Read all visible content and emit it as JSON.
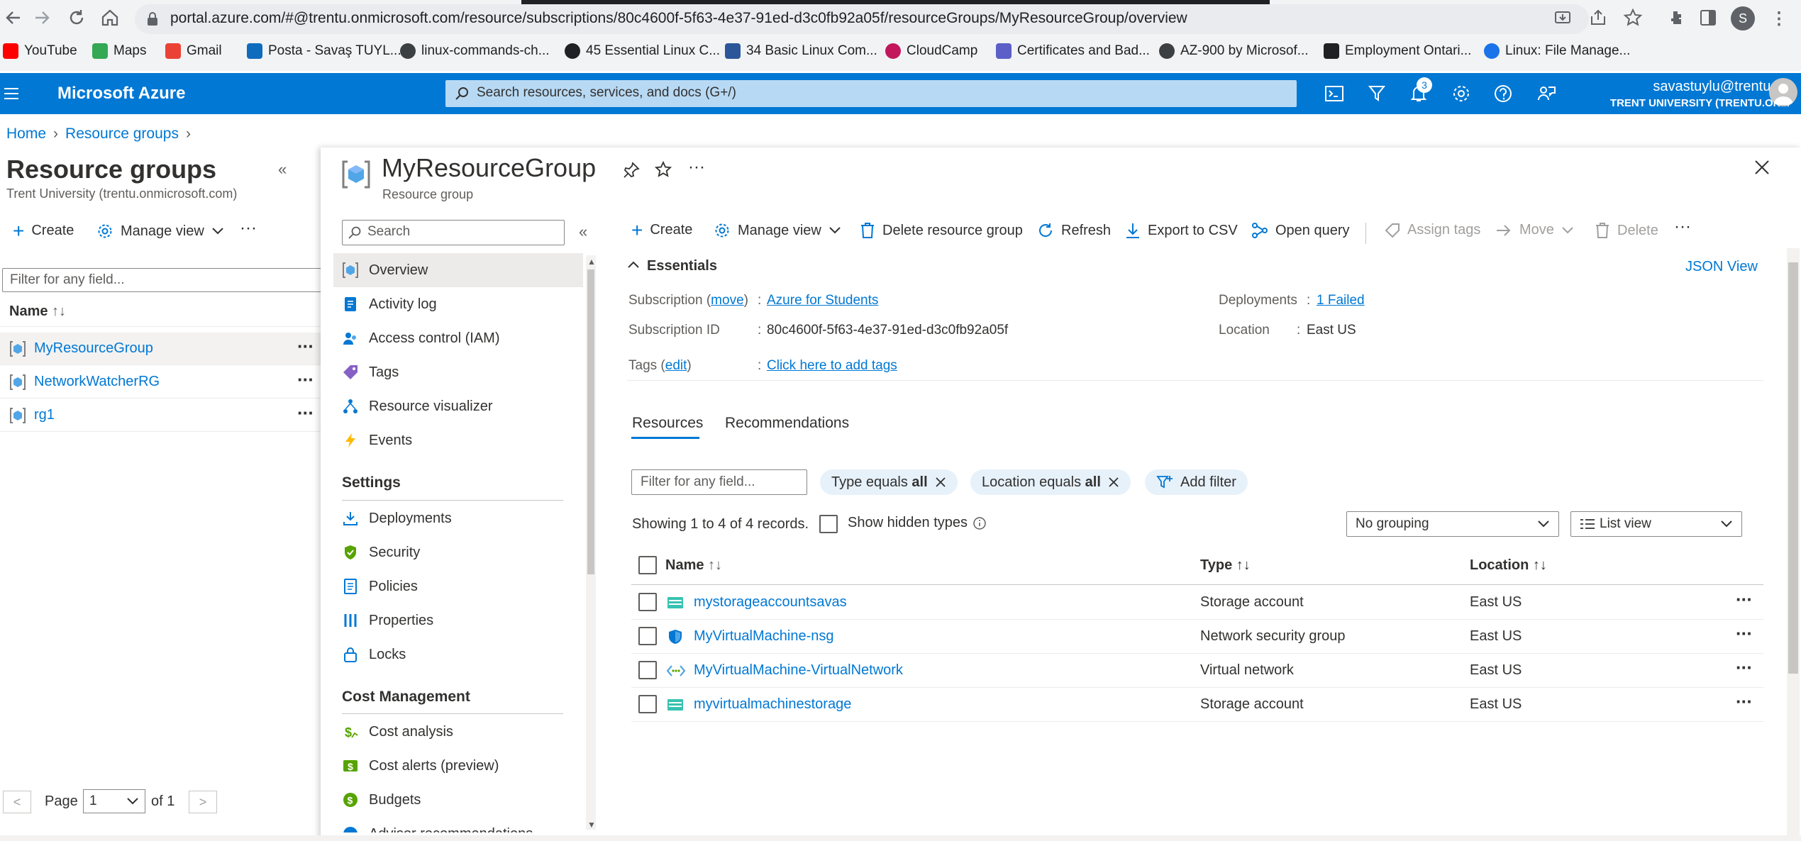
{
  "browser": {
    "url": "portal.azure.com/#@trentu.onmicrosoft.com/resource/subscriptions/80c4600f-5f63-4e37-91ed-d3c0fb92a05f/resourceGroups/MyResourceGroup/overview",
    "bookmarks": [
      {
        "label": "YouTube",
        "color": "#ff0000"
      },
      {
        "label": "Maps",
        "color": "#34a853"
      },
      {
        "label": "Gmail",
        "color": "#ea4335"
      },
      {
        "label": "Posta - Savaş TUYL...",
        "color": "#0f6cbd"
      },
      {
        "label": "linux-commands-ch...",
        "color": "#3c4043"
      },
      {
        "label": "45 Essential Linux C...",
        "color": "#202124"
      },
      {
        "label": "34 Basic Linux Com...",
        "color": "#2b579a"
      },
      {
        "label": "CloudCamp",
        "color": "#c2185b"
      },
      {
        "label": "Certificates and Bad...",
        "color": "#5b5fc7"
      },
      {
        "label": "AZ-900 by Microsof...",
        "color": "#3c4043"
      },
      {
        "label": "Employment Ontari...",
        "color": "#202124"
      },
      {
        "label": "Linux: File Manage...",
        "color": "#1a73e8"
      }
    ],
    "profile_initial": "S"
  },
  "header": {
    "brand": "Microsoft Azure",
    "search_placeholder": "Search resources, services, and docs (G+/)",
    "notification_count": "3",
    "user_name": "savastuylu@trentu.ca",
    "user_org": "TRENT UNIVERSITY (TRENTU.ON..."
  },
  "breadcrumb": {
    "home": "Home",
    "rg": "Resource groups"
  },
  "left_blade": {
    "title": "Resource groups",
    "subtitle": "Trent University (trentu.onmicrosoft.com)",
    "create": "Create",
    "manage_view": "Manage view",
    "filter_placeholder": "Filter for any field...",
    "name_header": "Name",
    "items": [
      {
        "name": "MyResourceGroup"
      },
      {
        "name": "NetworkWatcherRG"
      },
      {
        "name": "rg1"
      }
    ],
    "paging": {
      "prev": "<",
      "page_label": "Page",
      "page_value": "1",
      "of_label": "of 1",
      "next": ">"
    }
  },
  "resource_group": {
    "title": "MyResourceGroup",
    "subtitle": "Resource group",
    "menu_search": "Search",
    "menu": [
      {
        "label": "Overview",
        "icon": "overview-icon"
      },
      {
        "label": "Activity log",
        "icon": "activity-log-icon"
      },
      {
        "label": "Access control (IAM)",
        "icon": "iam-icon"
      },
      {
        "label": "Tags",
        "icon": "tag-icon"
      },
      {
        "label": "Resource visualizer",
        "icon": "visualizer-icon"
      },
      {
        "label": "Events",
        "icon": "lightning-icon"
      }
    ],
    "settings_header": "Settings",
    "settings": [
      {
        "label": "Deployments",
        "icon": "deployments-icon"
      },
      {
        "label": "Security",
        "icon": "shield-icon"
      },
      {
        "label": "Policies",
        "icon": "policy-icon"
      },
      {
        "label": "Properties",
        "icon": "properties-icon"
      },
      {
        "label": "Locks",
        "icon": "lock-icon"
      }
    ],
    "cost_header": "Cost Management",
    "cost": [
      {
        "label": "Cost analysis",
        "icon": "cost-analysis-icon"
      },
      {
        "label": "Cost alerts (preview)",
        "icon": "cost-alerts-icon"
      },
      {
        "label": "Budgets",
        "icon": "budgets-icon"
      },
      {
        "label": "Advisor recommendations",
        "icon": "advisor-icon"
      }
    ]
  },
  "toolbar": {
    "create": "Create",
    "manage_view": "Manage view",
    "delete_rg": "Delete resource group",
    "refresh": "Refresh",
    "export": "Export to CSV",
    "open_query": "Open query",
    "assign_tags": "Assign tags",
    "move": "Move",
    "delete": "Delete"
  },
  "essentials": {
    "header": "Essentials",
    "json_view": "JSON View",
    "subscription_label": "Subscription",
    "move_link": "move",
    "subscription_value": "Azure for Students",
    "subscription_id_label": "Subscription ID",
    "subscription_id": "80c4600f-5f63-4e37-91ed-d3c0fb92a05f",
    "tags_label": "Tags",
    "edit_link": "edit",
    "tags_value": "Click here to add tags",
    "deployments_label": "Deployments",
    "deployments_value": "1 Failed",
    "location_label": "Location",
    "location_value": "East US"
  },
  "tabs": {
    "resources": "Resources",
    "recommendations": "Recommendations"
  },
  "filters": {
    "placeholder": "Filter for any field...",
    "type_pill_prefix": "Type equals ",
    "type_pill_value": "all",
    "location_pill_prefix": "Location equals ",
    "location_pill_value": "all",
    "add_filter": "Add filter",
    "showing": "Showing 1 to 4 of 4 records.",
    "show_hidden": "Show hidden types",
    "grouping": "No grouping",
    "view": "List view"
  },
  "table": {
    "headers": {
      "name": "Name",
      "type": "Type",
      "location": "Location"
    },
    "rows": [
      {
        "name": "mystorageaccountsavas",
        "type": "Storage account",
        "location": "East US",
        "icon": "storage-account-icon"
      },
      {
        "name": "MyVirtualMachine-nsg",
        "type": "Network security group",
        "location": "East US",
        "icon": "nsg-shield-icon"
      },
      {
        "name": "MyVirtualMachine-VirtualNetwork",
        "type": "Virtual network",
        "location": "East US",
        "icon": "vnet-icon"
      },
      {
        "name": "myvirtualmachinestorage",
        "type": "Storage account",
        "location": "East US",
        "icon": "storage-account-icon"
      }
    ]
  },
  "colors": {
    "azure_blue": "#0078d4",
    "link": "#0078d4",
    "pill_bg": "#e7f1fa"
  }
}
